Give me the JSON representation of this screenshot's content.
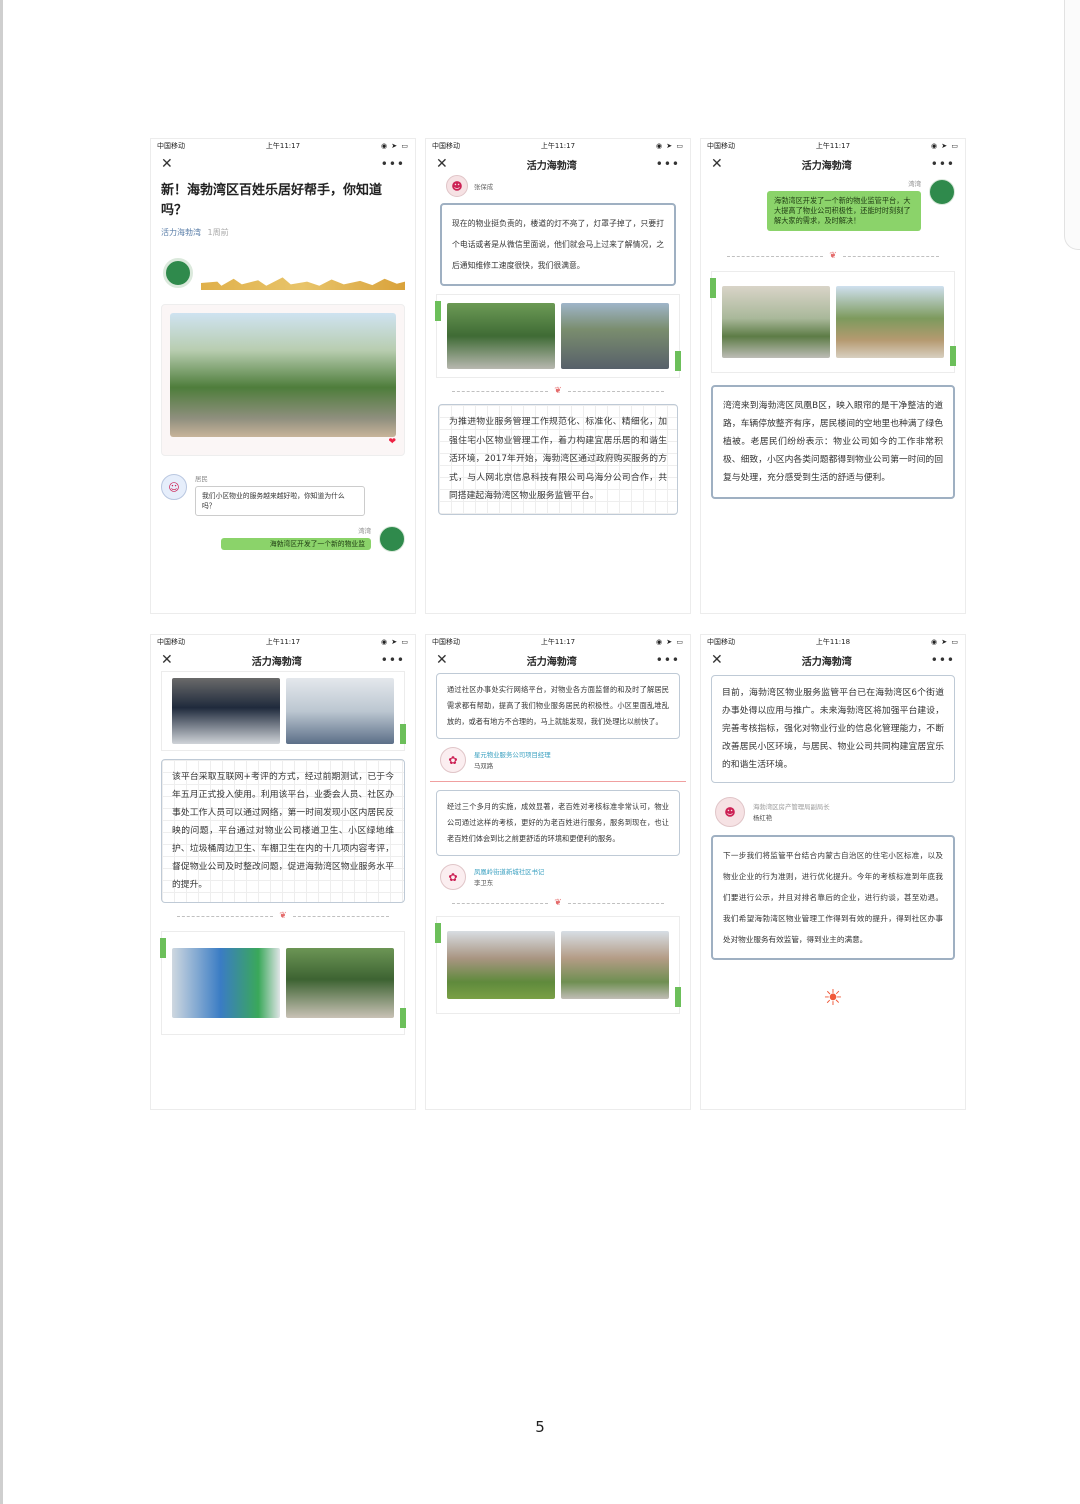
{
  "status": {
    "carrier": "中国移动",
    "time_a": "上午11:17",
    "time_b": "上午11:18"
  },
  "nav_title": "活力海勃湾",
  "p1": {
    "title": "新！海勃湾区百姓乐居好帮手，你知道吗？",
    "source": "活力海勃湾",
    "age": "1周前",
    "resident_name": "居民",
    "resident_msg": "我们小区物业的服务越来越好啦，你知道为什么吗？",
    "host_name": "湾湾",
    "host_msg": "海勃湾区开发了一个新的物业监"
  },
  "p2": {
    "top_name": "张保成",
    "quote": "现在的物业挺负责的，楼道的灯不亮了，灯罩子掉了，只要打个电话或者是从微信里面说，他们就会马上过来了解情况，之后通知维修工速度很快，我们很满意。",
    "body": "为推进物业服务管理工作规范化、标准化、精细化，加强住宅小区物业管理工作，着力构建宜居乐居的和谐生活环境，2017年开始，海勃湾区通过政府购买服务的方式，与人网北京信息科技有限公司乌海分公司合作，共同搭建起海勃湾区物业服务监管平台。"
  },
  "p3": {
    "host_name": "湾湾",
    "host_msg": "海勃湾区开发了一个新的物业监管平台，大大提高了物业公司积极性，还能时时刻刻了解大家的需求，及时解决！",
    "body": "湾湾来到海勃湾区凤凰B区，映入眼帘的是干净整洁的道路，车辆停放整齐有序，居民楼间的空地里也种满了绿色植被。老居民们纷纷表示：物业公司如今的工作非常积极、细致，小区内各类问题都得到物业公司第一时间的回复与处理，充分感受到生活的舒适与便利。"
  },
  "p4": {
    "body": "该平台采取互联网+考评的方式，经过前期测试，已于今年五月正式投入使用。利用该平台，业委会人员、社区办事处工作人员可以通过网络，第一时间发现小区内居民反映的问题，平台通过对物业公司楼道卫生、小区绿地维护、垃圾桶周边卫生、车棚卫生在内的十几项内容考评，督促物业公司及时整改问题，促进海勃湾区物业服务水平的提升。"
  },
  "p5": {
    "quote1": "通过社区办事处实行网络平台，对物业各方面监督的和及时了解居民需求都有帮助，提高了我们物业服务居民的积极性。小区里面乱堆乱放的，或者有地方不合理的，马上就能发现，我们处理比以前快了。",
    "person1_title": "星元物业服务公司项目经理",
    "person1_name": "马双路",
    "quote2": "经过三个多月的实施，成效显著，老百姓对考核标准非常认可，物业公司通过这样的考核，更好的为老百姓进行服务，服务到现在，也让老百姓们体会到比之前更舒适的环境和更便利的服务。",
    "person2_title": "凤凰岭街道新城社区书记",
    "person2_name": "李卫东"
  },
  "p6": {
    "body": "目前，海勃湾区物业服务监管平台已在海勃湾区6个街道办事处得以应用与推广。未来海勃湾区将加强平台建设，完善考核指标，强化对物业行业的信息化管理能力，不断改善居民小区环境，与居民、物业公司共同构建宜居宜乐的和谐生活环境。",
    "person_title": "海勃湾区房产管理局副局长",
    "person_name": "杨红艳",
    "quote": "下一步我们将监管平台结合内蒙古自治区的住宅小区标准，以及物业企业的行为准则，进行优化提升。今年的考核标准到年底我们要进行公示，并且对排名靠后的企业，进行约谈，甚至劝退。我们希望海勃湾区物业管理工作得到有效的提升，得到社区办事处对物业服务有效监管，得到业主的满意。"
  },
  "page_number": "5"
}
